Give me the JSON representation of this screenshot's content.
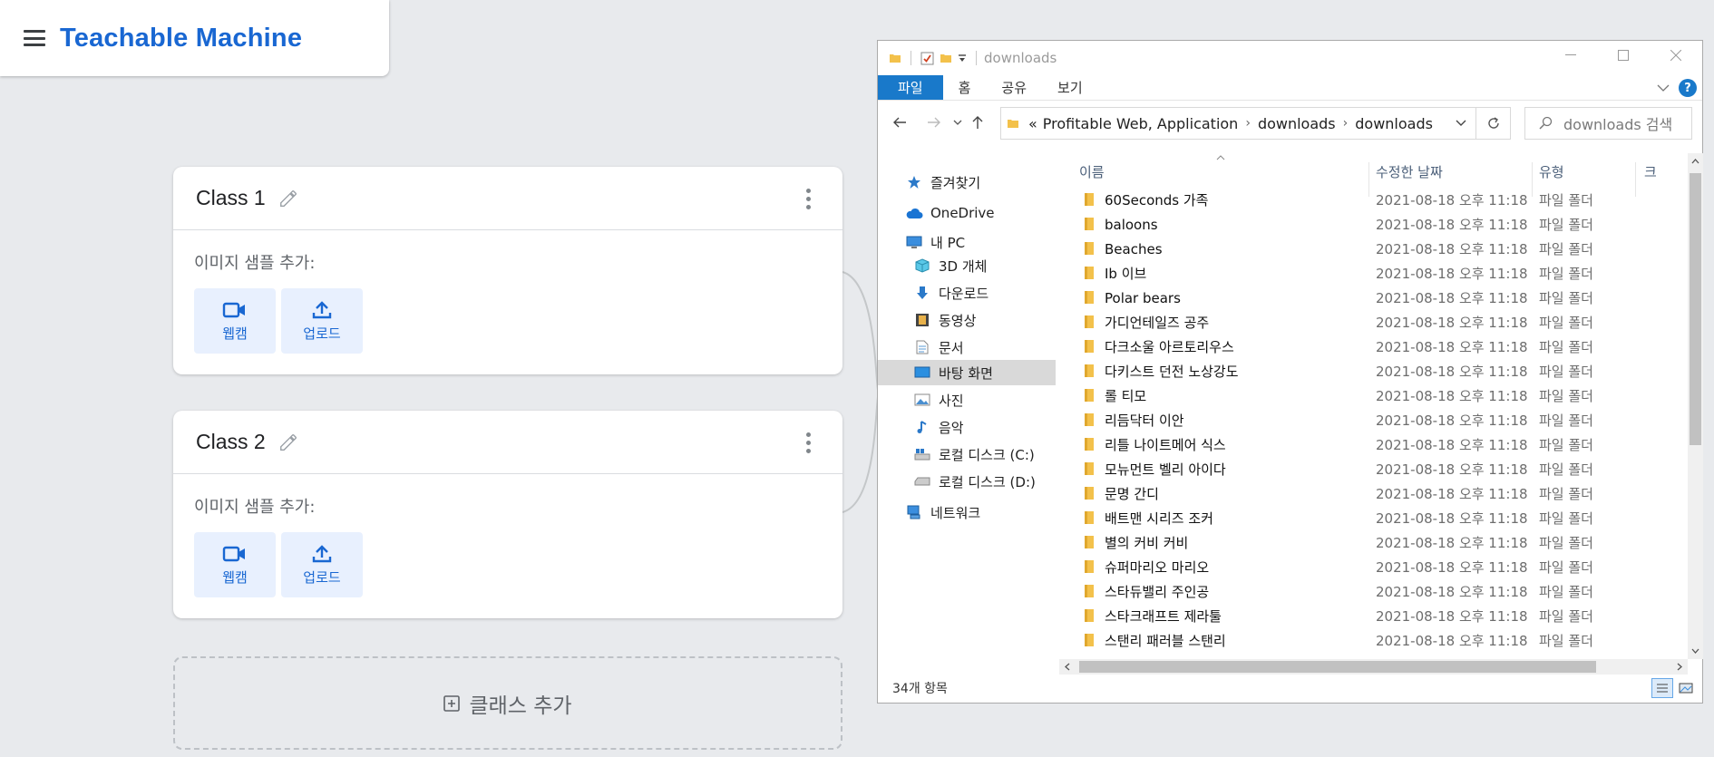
{
  "tm": {
    "logo": "Teachable Machine",
    "classes": [
      {
        "title": "Class 1",
        "add_label": "이미지 샘플 추가:",
        "webcam": "웹캠",
        "upload": "업로드"
      },
      {
        "title": "Class 2",
        "add_label": "이미지 샘플 추가:",
        "webcam": "웹캠",
        "upload": "업로드"
      }
    ],
    "add_class": "클래스 추가"
  },
  "explorer": {
    "title": "downloads",
    "ribbon": {
      "file": "파일",
      "home": "홈",
      "share": "공유",
      "view": "보기"
    },
    "address": {
      "prefix": "«",
      "crumbs": [
        "Profitable Web, Application",
        "downloads",
        "downloads"
      ]
    },
    "search_placeholder": "downloads 검색",
    "nav": {
      "favorites": "즐겨찾기",
      "onedrive": "OneDrive",
      "pc": "내 PC",
      "objects3d": "3D 개체",
      "downloads": "다운로드",
      "videos": "동영상",
      "documents": "문서",
      "desktop": "바탕 화면",
      "pictures": "사진",
      "music": "음악",
      "disk_c": "로컬 디스크 (C:)",
      "disk_d": "로컬 디스크 (D:)",
      "network": "네트워크"
    },
    "columns": {
      "name": "이름",
      "date": "수정한 날짜",
      "type": "유형",
      "size": "크"
    },
    "files": [
      {
        "name": "60Seconds 가족",
        "date": "2021-08-18 오후 11:18",
        "type": "파일 폴더"
      },
      {
        "name": "baloons",
        "date": "2021-08-18 오후 11:18",
        "type": "파일 폴더"
      },
      {
        "name": "Beaches",
        "date": "2021-08-18 오후 11:18",
        "type": "파일 폴더"
      },
      {
        "name": "Ib 이브",
        "date": "2021-08-18 오후 11:18",
        "type": "파일 폴더"
      },
      {
        "name": "Polar bears",
        "date": "2021-08-18 오후 11:18",
        "type": "파일 폴더"
      },
      {
        "name": "가디언테일즈 공주",
        "date": "2021-08-18 오후 11:18",
        "type": "파일 폴더"
      },
      {
        "name": "다크소울 아르토리우스",
        "date": "2021-08-18 오후 11:18",
        "type": "파일 폴더"
      },
      {
        "name": "다키스트 던전 노상강도",
        "date": "2021-08-18 오후 11:18",
        "type": "파일 폴더"
      },
      {
        "name": "롤 티모",
        "date": "2021-08-18 오후 11:18",
        "type": "파일 폴더"
      },
      {
        "name": "리듬닥터 이안",
        "date": "2021-08-18 오후 11:18",
        "type": "파일 폴더"
      },
      {
        "name": "리틀 나이트메어 식스",
        "date": "2021-08-18 오후 11:18",
        "type": "파일 폴더"
      },
      {
        "name": "모뉴먼트 벨리 아이다",
        "date": "2021-08-18 오후 11:18",
        "type": "파일 폴더"
      },
      {
        "name": "문명 간디",
        "date": "2021-08-18 오후 11:18",
        "type": "파일 폴더"
      },
      {
        "name": "배트맨 시리즈 조커",
        "date": "2021-08-18 오후 11:18",
        "type": "파일 폴더"
      },
      {
        "name": "별의 커비 커비",
        "date": "2021-08-18 오후 11:18",
        "type": "파일 폴더"
      },
      {
        "name": "슈퍼마리오 마리오",
        "date": "2021-08-18 오후 11:18",
        "type": "파일 폴더"
      },
      {
        "name": "스타듀밸리 주인공",
        "date": "2021-08-18 오후 11:18",
        "type": "파일 폴더"
      },
      {
        "name": "스타크래프트 제라툴",
        "date": "2021-08-18 오후 11:18",
        "type": "파일 폴더"
      },
      {
        "name": "스탠리 패러블 스탠리",
        "date": "2021-08-18 오후 11:18",
        "type": "파일 폴더"
      }
    ],
    "status": "34개 항목",
    "colors": {
      "accent": "#1979ca",
      "folder": "#f3c14b",
      "tm_blue": "#1967d2"
    }
  }
}
